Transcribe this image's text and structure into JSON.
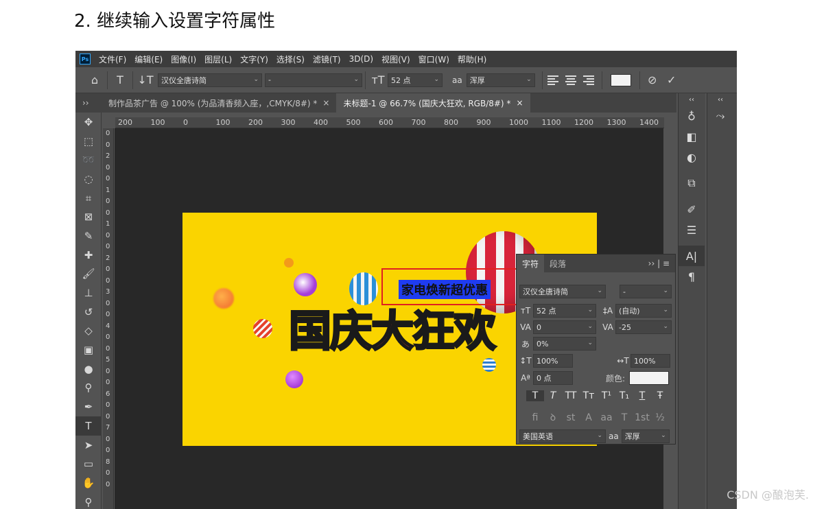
{
  "heading": "2.  继续输入设置字符属性",
  "menu": [
    "文件(F)",
    "编辑(E)",
    "图像(I)",
    "图层(L)",
    "文字(Y)",
    "选择(S)",
    "滤镜(T)",
    "3D(D)",
    "视图(V)",
    "窗口(W)",
    "帮助(H)"
  ],
  "logo": "Ps",
  "options": {
    "font_family": "汉仪全唐诗简",
    "font_style": "-",
    "font_size": "52 点",
    "aa_label": "aa",
    "aa_mode": "浑厚",
    "swatch_color": "#f2f2f2"
  },
  "tabs": [
    {
      "label": "制作品茶广告 @ 100% (为品清香频入座，,CMYK/8#) *",
      "close": "×"
    },
    {
      "label": "未标题-1 @ 66.7% (国庆大狂欢, RGB/8#) *",
      "close": "×"
    }
  ],
  "ruler_top": [
    "200",
    "100",
    "0",
    "100",
    "200",
    "300",
    "400",
    "500",
    "600",
    "700",
    "800",
    "900",
    "1000",
    "1100",
    "1200",
    "1300",
    "1400"
  ],
  "ruler_left": [
    "0",
    "0",
    "2",
    "0",
    "0",
    "1",
    "0",
    "0",
    "1",
    "0",
    "0",
    "2",
    "0",
    "0",
    "3",
    "0",
    "0",
    "4",
    "0",
    "0",
    "5",
    "0",
    "0",
    "6",
    "0",
    "0",
    "7",
    "0",
    "0",
    "8",
    "0",
    "0"
  ],
  "canvas": {
    "selected_text": "家电焕新超优惠",
    "big_title": "国庆大狂欢",
    "bg_color": "#fad400"
  },
  "char_panel": {
    "tab_char": "字符",
    "tab_para": "段落",
    "collapse": "››",
    "menu": "≡",
    "font_family": "汉仪全唐诗简",
    "font_style": "-",
    "size": "52 点",
    "leading": "(自动)",
    "kerning": "0",
    "tracking": "-25",
    "scale_pct": "0%",
    "vscale": "100%",
    "hscale": "100%",
    "baseline": "0 点",
    "color_label": "颜色:",
    "color": "#f3f3f3",
    "language": "美国英语",
    "aa_label": "aa",
    "aa_mode": "浑厚",
    "style_buttons": [
      "T",
      "T",
      "TT",
      "Tт",
      "T¹",
      "T₁",
      "T",
      "Ŧ"
    ],
    "glyph_buttons": [
      "fi",
      "ꝺ",
      "st",
      "A",
      "aa",
      "T",
      "1st",
      "½"
    ]
  },
  "watermark": "CSDN @酿泡芙."
}
